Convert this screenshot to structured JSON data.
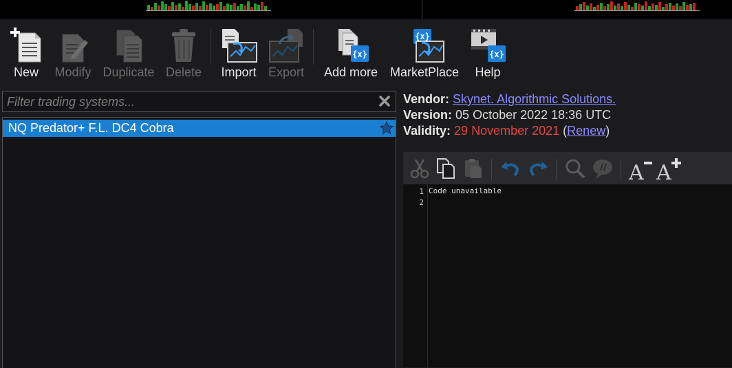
{
  "toolbar": {
    "new": "New",
    "modify": "Modify",
    "duplicate": "Duplicate",
    "delete": "Delete",
    "import": "Import",
    "export": "Export",
    "add_more": "Add more",
    "marketplace": "MarketPlace",
    "help": "Help"
  },
  "icons": {
    "new": "new-document-icon",
    "modify": "edit-document-icon",
    "duplicate": "duplicate-documents-icon",
    "delete": "trash-icon",
    "import": "import-chart-icon",
    "export": "export-chart-icon",
    "add_more": "add-more-icon",
    "marketplace": "marketplace-icon",
    "help": "help-video-icon",
    "filter_clear": "close-icon",
    "favorite": "star-icon"
  },
  "filter": {
    "placeholder": "Filter trading systems...",
    "value": ""
  },
  "systems": [
    {
      "name": "NQ Predator+ F.L. DC4 Cobra",
      "selected": true,
      "favorite": true
    }
  ],
  "info": {
    "vendor_label": "Vendor:",
    "vendor_value": "Skynet. Algorithmic Solutions.",
    "version_label": "Version:",
    "version_value": "05 October 2022 18:36 UTC",
    "validity_label": "Validity:",
    "validity_value": "29 November 2021",
    "renew_open": "(",
    "renew_link": "Renew",
    "renew_close": ")"
  },
  "editor": {
    "line_numbers": [
      "1",
      "2"
    ],
    "lines": [
      "Code unavailable",
      ""
    ],
    "tools": [
      "cut-icon",
      "copy-icon",
      "paste-icon",
      "undo-icon",
      "redo-icon",
      "search-icon",
      "comment-icon",
      "decrease-font-icon",
      "increase-font-icon"
    ]
  },
  "colors": {
    "background": "#1b1b1d",
    "selection": "#1a7fd0",
    "link": "#8a8aff",
    "expired": "#e64545",
    "accent_icon": "#1e7fd8"
  }
}
